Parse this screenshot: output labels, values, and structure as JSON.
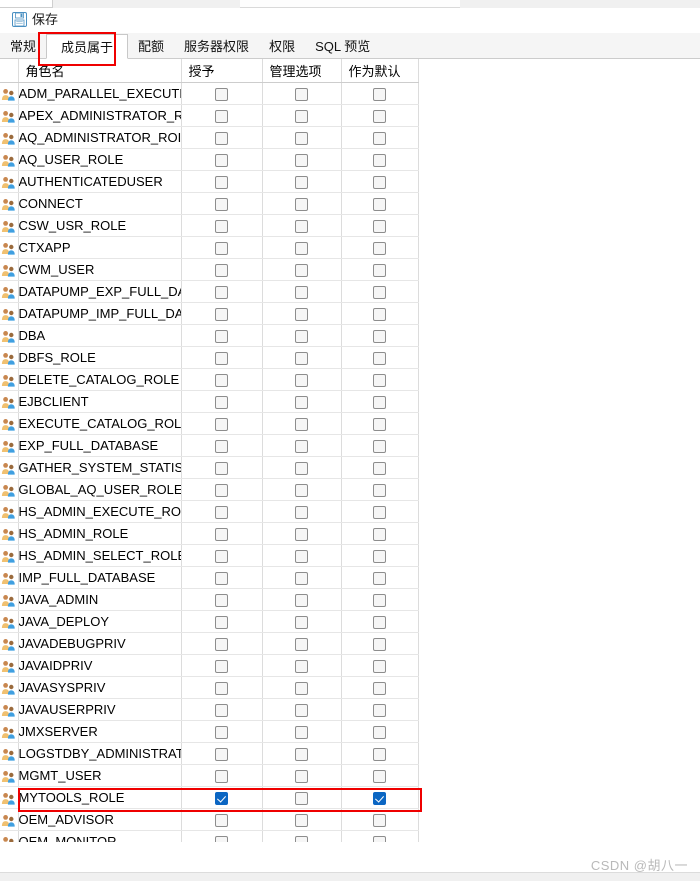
{
  "window": {
    "toolbar": {
      "save_icon": "floppy-disk-save-icon",
      "save_label": "保存"
    },
    "tabs": [
      {
        "label": "常规",
        "active": false
      },
      {
        "label": "成员属于",
        "active": true
      },
      {
        "label": "配额",
        "active": false
      },
      {
        "label": "服务器权限",
        "active": false
      },
      {
        "label": "权限",
        "active": false
      },
      {
        "label": "SQL 预览",
        "active": false
      }
    ]
  },
  "annotations": {
    "accent_color": "#ef0000",
    "tab_highlight_target": "成员属于",
    "row_highlight_target": "MYTOOLS_ROLE"
  },
  "grid": {
    "columns": [
      "角色名",
      "授予",
      "管理选项",
      "作为默认"
    ],
    "row_icon": "role-group-icon",
    "checked_color": "#0b66c3",
    "rows": [
      {
        "name": "ADM_PARALLEL_EXECUTE_",
        "grant": false,
        "admin": false,
        "default": false,
        "highlight": false
      },
      {
        "name": "APEX_ADMINISTRATOR_R",
        "grant": false,
        "admin": false,
        "default": false,
        "highlight": false
      },
      {
        "name": "AQ_ADMINISTRATOR_ROI",
        "grant": false,
        "admin": false,
        "default": false,
        "highlight": false
      },
      {
        "name": "AQ_USER_ROLE",
        "grant": false,
        "admin": false,
        "default": false,
        "highlight": false
      },
      {
        "name": "AUTHENTICATEDUSER",
        "grant": false,
        "admin": false,
        "default": false,
        "highlight": false
      },
      {
        "name": "CONNECT",
        "grant": false,
        "admin": false,
        "default": false,
        "highlight": false
      },
      {
        "name": "CSW_USR_ROLE",
        "grant": false,
        "admin": false,
        "default": false,
        "highlight": false
      },
      {
        "name": "CTXAPP",
        "grant": false,
        "admin": false,
        "default": false,
        "highlight": false
      },
      {
        "name": "CWM_USER",
        "grant": false,
        "admin": false,
        "default": false,
        "highlight": false
      },
      {
        "name": "DATAPUMP_EXP_FULL_DA",
        "grant": false,
        "admin": false,
        "default": false,
        "highlight": false
      },
      {
        "name": "DATAPUMP_IMP_FULL_DA",
        "grant": false,
        "admin": false,
        "default": false,
        "highlight": false
      },
      {
        "name": "DBA",
        "grant": false,
        "admin": false,
        "default": false,
        "highlight": false
      },
      {
        "name": "DBFS_ROLE",
        "grant": false,
        "admin": false,
        "default": false,
        "highlight": false
      },
      {
        "name": "DELETE_CATALOG_ROLE",
        "grant": false,
        "admin": false,
        "default": false,
        "highlight": false
      },
      {
        "name": "EJBCLIENT",
        "grant": false,
        "admin": false,
        "default": false,
        "highlight": false
      },
      {
        "name": "EXECUTE_CATALOG_ROLE",
        "grant": false,
        "admin": false,
        "default": false,
        "highlight": false
      },
      {
        "name": "EXP_FULL_DATABASE",
        "grant": false,
        "admin": false,
        "default": false,
        "highlight": false
      },
      {
        "name": "GATHER_SYSTEM_STATIST",
        "grant": false,
        "admin": false,
        "default": false,
        "highlight": false
      },
      {
        "name": "GLOBAL_AQ_USER_ROLE",
        "grant": false,
        "admin": false,
        "default": false,
        "highlight": false
      },
      {
        "name": "HS_ADMIN_EXECUTE_ROL",
        "grant": false,
        "admin": false,
        "default": false,
        "highlight": false
      },
      {
        "name": "HS_ADMIN_ROLE",
        "grant": false,
        "admin": false,
        "default": false,
        "highlight": false
      },
      {
        "name": "HS_ADMIN_SELECT_ROLE",
        "grant": false,
        "admin": false,
        "default": false,
        "highlight": false
      },
      {
        "name": "IMP_FULL_DATABASE",
        "grant": false,
        "admin": false,
        "default": false,
        "highlight": false
      },
      {
        "name": "JAVA_ADMIN",
        "grant": false,
        "admin": false,
        "default": false,
        "highlight": false
      },
      {
        "name": "JAVA_DEPLOY",
        "grant": false,
        "admin": false,
        "default": false,
        "highlight": false
      },
      {
        "name": "JAVADEBUGPRIV",
        "grant": false,
        "admin": false,
        "default": false,
        "highlight": false
      },
      {
        "name": "JAVAIDPRIV",
        "grant": false,
        "admin": false,
        "default": false,
        "highlight": false
      },
      {
        "name": "JAVASYSPRIV",
        "grant": false,
        "admin": false,
        "default": false,
        "highlight": false
      },
      {
        "name": "JAVAUSERPRIV",
        "grant": false,
        "admin": false,
        "default": false,
        "highlight": false
      },
      {
        "name": "JMXSERVER",
        "grant": false,
        "admin": false,
        "default": false,
        "highlight": false
      },
      {
        "name": "LOGSTDBY_ADMINISTRAT",
        "grant": false,
        "admin": false,
        "default": false,
        "highlight": false
      },
      {
        "name": "MGMT_USER",
        "grant": false,
        "admin": false,
        "default": false,
        "highlight": false
      },
      {
        "name": "MYTOOLS_ROLE",
        "grant": true,
        "admin": false,
        "default": true,
        "highlight": true
      },
      {
        "name": "OEM_ADVISOR",
        "grant": false,
        "admin": false,
        "default": false,
        "highlight": false
      },
      {
        "name": "OEM_MONITOR",
        "grant": false,
        "admin": false,
        "default": false,
        "highlight": false
      }
    ]
  },
  "watermark": {
    "text": "CSDN @胡八一"
  }
}
